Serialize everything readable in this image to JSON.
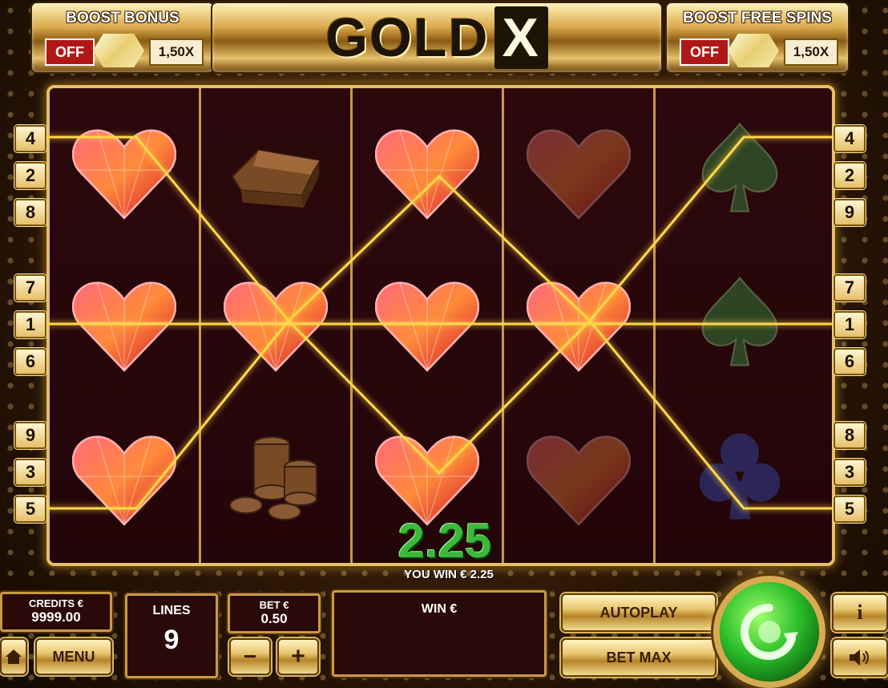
{
  "header": {
    "logo_text": "GOLD",
    "logo_x": "X",
    "boost_bonus": {
      "title": "BOOST BONUS",
      "toggle": "OFF",
      "multiplier": "1,50X"
    },
    "boost_free_spins": {
      "title": "BOOST FREE SPINS",
      "toggle": "OFF",
      "multiplier": "1,50X"
    }
  },
  "line_numbers": {
    "left": [
      "4",
      "2",
      "8",
      "7",
      "1",
      "6",
      "9",
      "3",
      "5"
    ],
    "right": [
      "4",
      "2",
      "9",
      "7",
      "1",
      "6",
      "8",
      "3",
      "5"
    ]
  },
  "reels": [
    [
      "heart",
      "gold-bar-icon",
      "heart",
      "heart-dim",
      "spade-dim"
    ],
    [
      "heart",
      "heart",
      "heart",
      "heart",
      "spade-dim"
    ],
    [
      "heart",
      "coins-icon",
      "heart",
      "heart-dim",
      "club-dim"
    ]
  ],
  "win": {
    "amount": "2.25",
    "message": "YOU WIN € 2.25"
  },
  "footer": {
    "credits_label": "CREDITS €",
    "credits_value": "9999.00",
    "lines_label": "LINES",
    "lines_value": "9",
    "bet_label": "BET €",
    "bet_value": "0.50",
    "win_label": "WIN €",
    "menu": "MENU",
    "autoplay": "AUTOPLAY",
    "bet_max": "BET MAX",
    "minus": "−",
    "plus": "+",
    "info": "i"
  },
  "colors": {
    "gold": "#e6c06a",
    "reel_bg": "#2a0a0c",
    "payline": "#ffd84a",
    "win_green": "#3cb83a",
    "toggle_off": "#b01818"
  }
}
